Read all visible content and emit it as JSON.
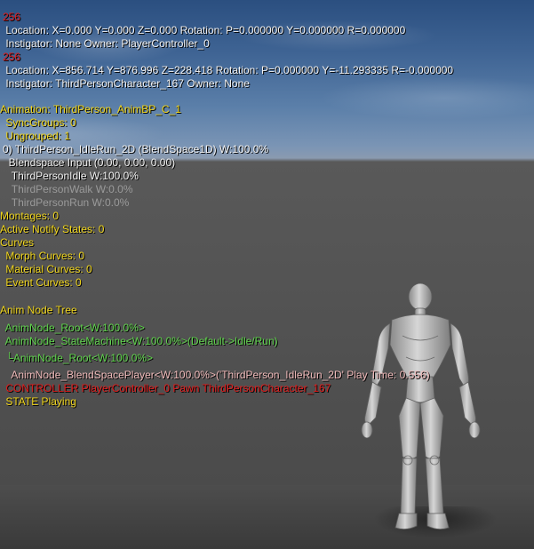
{
  "overlay": {
    "lines": [
      "256",
      " Location: X=0.000 Y=0.000 Z=0.000 Rotation: P=0.000000 Y=0.000000 R=0.000000",
      " Instigator: None Owner: PlayerController_0",
      "256",
      " Location: X=856.714 Y=876.996 Z=228.418 Rotation: P=0.000000 Y=-11.293335 R=-0.000000",
      " Instigator: ThirdPersonCharacter_167 Owner: None",
      "Animation: ThirdPerson_AnimBP_C_1",
      " SyncGroups: 0",
      " Ungrouped: 1",
      "0) ThirdPerson_IdleRun_2D (BlendSpace1D) W:100.0%",
      "  Blendspace Input (0.00, 0.00, 0.00)",
      "   ThirdPersonIdle W:100.0%",
      "   ThirdPersonWalk W:0.0%",
      "   ThirdPersonRun W:0.0%",
      "Montages: 0",
      "Active Notify States: 0",
      "Curves",
      " Morph Curves: 0",
      " Material Curves: 0",
      " Event Curves: 0",
      "Anim Node Tree",
      " AnimNode_Root<W:100.0%>",
      " AnimNode_StateMachine<W:100.0%>(Default->Idle/Run)",
      " └AnimNode_Root<W:100.0%>",
      "   AnimNode_BlendSpacePlayer<W:100.0%>('ThirdPerson_IdleRun_2D' Play Time: 0.556)",
      " CONTROLLER PlayerController_0 Pawn ThirdPersonCharacter_167",
      " STATE Playing"
    ]
  },
  "colors": {
    "red": "#e31b1b",
    "white": "#f2f2f2",
    "yellow": "#f0d51c",
    "gray": "#9a9a9a",
    "green": "#5fd34c",
    "pink": "#efb9b9"
  }
}
